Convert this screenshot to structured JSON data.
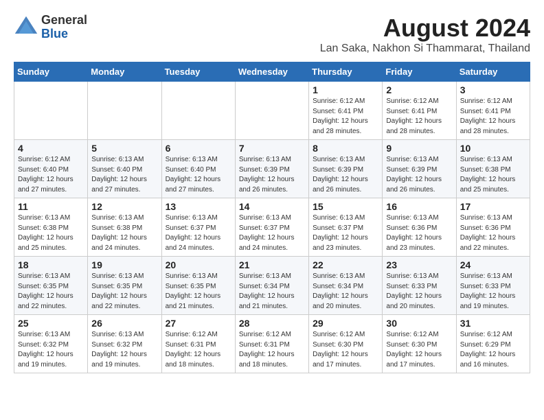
{
  "header": {
    "logo_general": "General",
    "logo_blue": "Blue",
    "month_year": "August 2024",
    "location": "Lan Saka, Nakhon Si Thammarat, Thailand"
  },
  "days_of_week": [
    "Sunday",
    "Monday",
    "Tuesday",
    "Wednesday",
    "Thursday",
    "Friday",
    "Saturday"
  ],
  "weeks": [
    [
      {
        "day": "",
        "info": ""
      },
      {
        "day": "",
        "info": ""
      },
      {
        "day": "",
        "info": ""
      },
      {
        "day": "",
        "info": ""
      },
      {
        "day": "1",
        "info": "Sunrise: 6:12 AM\nSunset: 6:41 PM\nDaylight: 12 hours\nand 28 minutes."
      },
      {
        "day": "2",
        "info": "Sunrise: 6:12 AM\nSunset: 6:41 PM\nDaylight: 12 hours\nand 28 minutes."
      },
      {
        "day": "3",
        "info": "Sunrise: 6:12 AM\nSunset: 6:41 PM\nDaylight: 12 hours\nand 28 minutes."
      }
    ],
    [
      {
        "day": "4",
        "info": "Sunrise: 6:12 AM\nSunset: 6:40 PM\nDaylight: 12 hours\nand 27 minutes."
      },
      {
        "day": "5",
        "info": "Sunrise: 6:13 AM\nSunset: 6:40 PM\nDaylight: 12 hours\nand 27 minutes."
      },
      {
        "day": "6",
        "info": "Sunrise: 6:13 AM\nSunset: 6:40 PM\nDaylight: 12 hours\nand 27 minutes."
      },
      {
        "day": "7",
        "info": "Sunrise: 6:13 AM\nSunset: 6:39 PM\nDaylight: 12 hours\nand 26 minutes."
      },
      {
        "day": "8",
        "info": "Sunrise: 6:13 AM\nSunset: 6:39 PM\nDaylight: 12 hours\nand 26 minutes."
      },
      {
        "day": "9",
        "info": "Sunrise: 6:13 AM\nSunset: 6:39 PM\nDaylight: 12 hours\nand 26 minutes."
      },
      {
        "day": "10",
        "info": "Sunrise: 6:13 AM\nSunset: 6:38 PM\nDaylight: 12 hours\nand 25 minutes."
      }
    ],
    [
      {
        "day": "11",
        "info": "Sunrise: 6:13 AM\nSunset: 6:38 PM\nDaylight: 12 hours\nand 25 minutes."
      },
      {
        "day": "12",
        "info": "Sunrise: 6:13 AM\nSunset: 6:38 PM\nDaylight: 12 hours\nand 24 minutes."
      },
      {
        "day": "13",
        "info": "Sunrise: 6:13 AM\nSunset: 6:37 PM\nDaylight: 12 hours\nand 24 minutes."
      },
      {
        "day": "14",
        "info": "Sunrise: 6:13 AM\nSunset: 6:37 PM\nDaylight: 12 hours\nand 24 minutes."
      },
      {
        "day": "15",
        "info": "Sunrise: 6:13 AM\nSunset: 6:37 PM\nDaylight: 12 hours\nand 23 minutes."
      },
      {
        "day": "16",
        "info": "Sunrise: 6:13 AM\nSunset: 6:36 PM\nDaylight: 12 hours\nand 23 minutes."
      },
      {
        "day": "17",
        "info": "Sunrise: 6:13 AM\nSunset: 6:36 PM\nDaylight: 12 hours\nand 22 minutes."
      }
    ],
    [
      {
        "day": "18",
        "info": "Sunrise: 6:13 AM\nSunset: 6:35 PM\nDaylight: 12 hours\nand 22 minutes."
      },
      {
        "day": "19",
        "info": "Sunrise: 6:13 AM\nSunset: 6:35 PM\nDaylight: 12 hours\nand 22 minutes."
      },
      {
        "day": "20",
        "info": "Sunrise: 6:13 AM\nSunset: 6:35 PM\nDaylight: 12 hours\nand 21 minutes."
      },
      {
        "day": "21",
        "info": "Sunrise: 6:13 AM\nSunset: 6:34 PM\nDaylight: 12 hours\nand 21 minutes."
      },
      {
        "day": "22",
        "info": "Sunrise: 6:13 AM\nSunset: 6:34 PM\nDaylight: 12 hours\nand 20 minutes."
      },
      {
        "day": "23",
        "info": "Sunrise: 6:13 AM\nSunset: 6:33 PM\nDaylight: 12 hours\nand 20 minutes."
      },
      {
        "day": "24",
        "info": "Sunrise: 6:13 AM\nSunset: 6:33 PM\nDaylight: 12 hours\nand 19 minutes."
      }
    ],
    [
      {
        "day": "25",
        "info": "Sunrise: 6:13 AM\nSunset: 6:32 PM\nDaylight: 12 hours\nand 19 minutes."
      },
      {
        "day": "26",
        "info": "Sunrise: 6:13 AM\nSunset: 6:32 PM\nDaylight: 12 hours\nand 19 minutes."
      },
      {
        "day": "27",
        "info": "Sunrise: 6:12 AM\nSunset: 6:31 PM\nDaylight: 12 hours\nand 18 minutes."
      },
      {
        "day": "28",
        "info": "Sunrise: 6:12 AM\nSunset: 6:31 PM\nDaylight: 12 hours\nand 18 minutes."
      },
      {
        "day": "29",
        "info": "Sunrise: 6:12 AM\nSunset: 6:30 PM\nDaylight: 12 hours\nand 17 minutes."
      },
      {
        "day": "30",
        "info": "Sunrise: 6:12 AM\nSunset: 6:30 PM\nDaylight: 12 hours\nand 17 minutes."
      },
      {
        "day": "31",
        "info": "Sunrise: 6:12 AM\nSunset: 6:29 PM\nDaylight: 12 hours\nand 16 minutes."
      }
    ]
  ]
}
